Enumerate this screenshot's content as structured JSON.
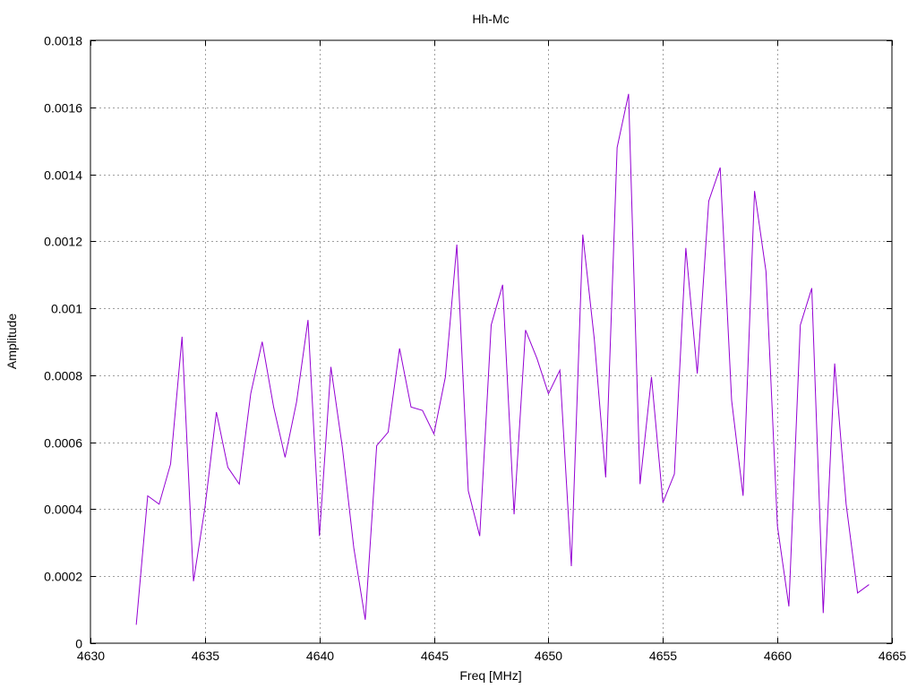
{
  "chart_data": {
    "type": "line",
    "title": "Hh-Mc",
    "xlabel": "Freq [MHz]",
    "ylabel": "Amplitude",
    "xlim": [
      4630,
      4665
    ],
    "ylim": [
      0,
      0.0018
    ],
    "x_ticks": [
      "4630",
      "4635",
      "4640",
      "4645",
      "4650",
      "4655",
      "4660",
      "4665"
    ],
    "y_ticks": [
      "0",
      "0.0002",
      "0.0004",
      "0.0006",
      "0.0008",
      "0.001",
      "0.0012",
      "0.0014",
      "0.0016",
      "0.0018"
    ],
    "grid": true,
    "series": [
      {
        "color": "#9400d3",
        "x": [
          4632.0,
          4632.5,
          4633.0,
          4633.5,
          4634.0,
          4634.5,
          4635.0,
          4635.5,
          4636.0,
          4636.5,
          4637.0,
          4637.5,
          4638.0,
          4638.5,
          4639.0,
          4639.5,
          4640.0,
          4640.5,
          4641.0,
          4641.5,
          4642.0,
          4642.5,
          4643.0,
          4643.5,
          4644.0,
          4644.5,
          4645.0,
          4645.5,
          4646.0,
          4646.5,
          4647.0,
          4647.5,
          4648.0,
          4648.5,
          4649.0,
          4649.5,
          4650.0,
          4650.5,
          4651.0,
          4651.5,
          4652.0,
          4652.5,
          4653.0,
          4653.5,
          4654.0,
          4654.5,
          4655.0,
          4655.5,
          4656.0,
          4656.5,
          4657.0,
          4657.5,
          4658.0,
          4658.5,
          4659.0,
          4659.5,
          4660.0,
          4660.5,
          4661.0,
          4661.5,
          4662.0,
          4662.5,
          4663.0,
          4663.5,
          4664.0
        ],
        "y": [
          5.5e-05,
          0.00044,
          0.000415,
          0.000535,
          0.000915,
          0.000185,
          0.000405,
          0.00069,
          0.000525,
          0.000475,
          0.000745,
          0.0009,
          0.000705,
          0.000555,
          0.00072,
          0.000965,
          0.00032,
          0.000825,
          0.000585,
          0.000285,
          7e-05,
          0.00059,
          0.00063,
          0.00088,
          0.000705,
          0.000695,
          0.000625,
          0.000795,
          0.00119,
          0.000455,
          0.00032,
          0.00095,
          0.00107,
          0.000385,
          0.000935,
          0.00085,
          0.000745,
          0.000815,
          0.00023,
          0.00122,
          0.00091,
          0.000495,
          0.00148,
          0.00164,
          0.000475,
          0.000795,
          0.00042,
          0.000505,
          0.00118,
          0.000805,
          0.00132,
          0.00142,
          0.000725,
          0.00044,
          0.00135,
          0.00111,
          0.00035,
          0.00011,
          0.00095,
          0.00106,
          9e-05,
          0.000835,
          0.000415,
          0.00015,
          0.000175
        ]
      }
    ]
  }
}
